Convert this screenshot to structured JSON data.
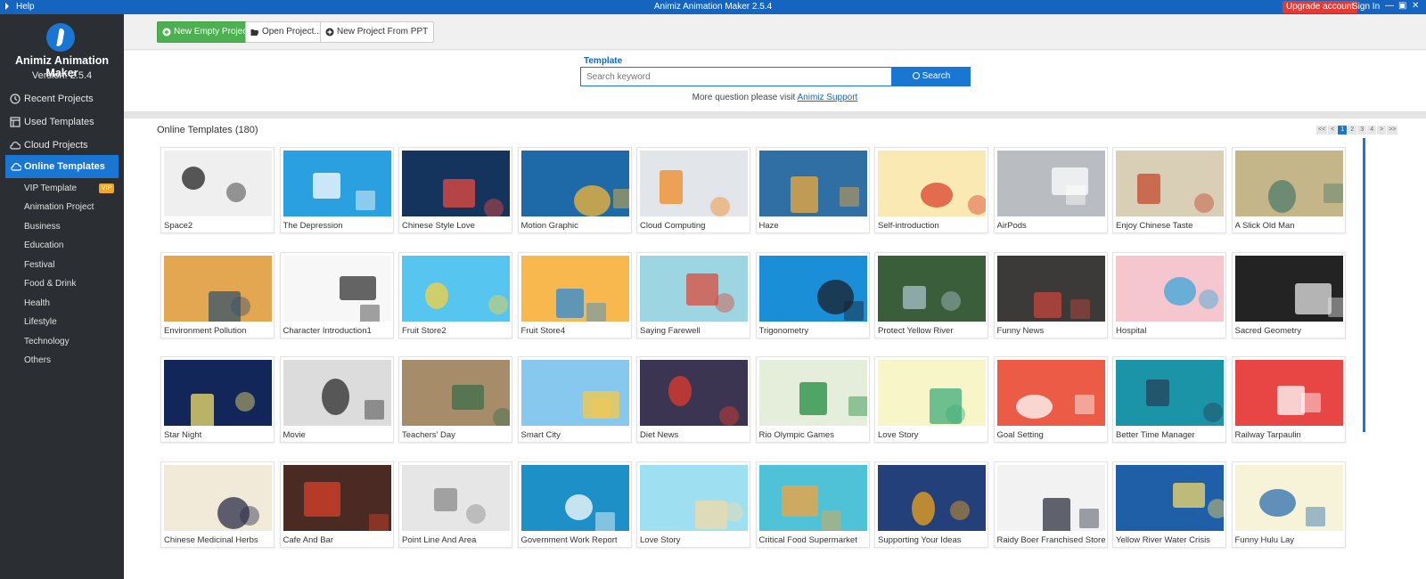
{
  "titlebar": {
    "help": "Help",
    "title": "Animiz Animation Maker 2.5.4",
    "upgrade": "Upgrade account",
    "signin": "Sign In",
    "controls": [
      "—",
      "▣",
      "❐",
      "✕"
    ]
  },
  "sidebar": {
    "brand": "Animiz Animation Maker",
    "version": "Version: 2.5.4",
    "nav": [
      {
        "label": "Recent Projects",
        "icon": "clock-icon"
      },
      {
        "label": "Used Templates",
        "icon": "template-icon"
      },
      {
        "label": "Cloud Projects",
        "icon": "cloud-icon"
      },
      {
        "label": "Online Templates",
        "icon": "cloud-icon",
        "active": true
      }
    ],
    "categories": [
      "VIP Template",
      "Animation Project",
      "Business",
      "Education",
      "Festival",
      "Food & Drink",
      "Health",
      "Lifestyle",
      "Technology",
      "Others"
    ],
    "vip_badge": "VIP"
  },
  "toolbar": {
    "new_empty": "New Empty Project",
    "open": "Open Project...",
    "new_ppt": "New Project From PPT"
  },
  "search": {
    "label": "Template",
    "placeholder": "Search keyword",
    "button": "Search",
    "support_text": "More question please visit",
    "support_link": "Animiz Support"
  },
  "templates": {
    "heading": "Online Templates (180)",
    "pager": [
      "<<",
      "<",
      "1",
      "2",
      "3",
      "4",
      ">",
      ">>"
    ],
    "current_page": "1",
    "items": [
      {
        "name": "Space2",
        "bg": "#efefef",
        "accent": "#222222"
      },
      {
        "name": "The Depression",
        "bg": "#2aa0e0",
        "accent": "#ffffff"
      },
      {
        "name": "Chinese Style Love",
        "bg": "#14345e",
        "accent": "#e94a3f"
      },
      {
        "name": "Motion Graphic",
        "bg": "#1e6aa8",
        "accent": "#f7b733"
      },
      {
        "name": "Cloud Computing",
        "bg": "#e2e6ea",
        "accent": "#f08a24"
      },
      {
        "name": "Haze",
        "bg": "#2f6fa3",
        "accent": "#f2a93b"
      },
      {
        "name": "Self-introduction",
        "bg": "#fbe9b3",
        "accent": "#d9412b"
      },
      {
        "name": "AirPods",
        "bg": "#b9bcc0",
        "accent": "#ffffff"
      },
      {
        "name": "Enjoy Chinese Taste",
        "bg": "#d9ceb6",
        "accent": "#c24a2c"
      },
      {
        "name": "A Slick Old Man",
        "bg": "#c5b68a",
        "accent": "#4e7c6a"
      },
      {
        "name": "Environment Pollution",
        "bg": "#e3a752",
        "accent": "#37536b"
      },
      {
        "name": "Character Introduction1",
        "bg": "#f7f7f7",
        "accent": "#333333"
      },
      {
        "name": "Fruit Store2",
        "bg": "#56c5f0",
        "accent": "#f7d23e"
      },
      {
        "name": "Fruit Store4",
        "bg": "#f8b84e",
        "accent": "#2e8bd8"
      },
      {
        "name": "Saying Farewell",
        "bg": "#9dd6e2",
        "accent": "#d94b3c"
      },
      {
        "name": "Trigonometry",
        "bg": "#1a8fd8",
        "accent": "#1b1f2a"
      },
      {
        "name": "Protect Yellow River",
        "bg": "#3b5e3a",
        "accent": "#a9c3c9"
      },
      {
        "name": "Funny News",
        "bg": "#3c3a38",
        "accent": "#c4463b"
      },
      {
        "name": "Hospital",
        "bg": "#f6c6cf",
        "accent": "#3aa6d8"
      },
      {
        "name": "Sacred Geometry",
        "bg": "#232323",
        "accent": "#e6e6e6"
      },
      {
        "name": "Star Night",
        "bg": "#13265a",
        "accent": "#f3e26b"
      },
      {
        "name": "Movie",
        "bg": "#dcdcdc",
        "accent": "#2b2b2b"
      },
      {
        "name": "Teachers' Day",
        "bg": "#a78c6a",
        "accent": "#3c6e4a"
      },
      {
        "name": "Smart City",
        "bg": "#86c8ee",
        "accent": "#f7c948"
      },
      {
        "name": "Diet News",
        "bg": "#3b3552",
        "accent": "#e23b2e"
      },
      {
        "name": "Rio Olympic Games",
        "bg": "#e5eedb",
        "accent": "#1e8c3f"
      },
      {
        "name": "Love Story",
        "bg": "#f8f5c8",
        "accent": "#3fae7a"
      },
      {
        "name": "Goal Setting",
        "bg": "#ec5b45",
        "accent": "#ffffff"
      },
      {
        "name": "Better Time Manager",
        "bg": "#1b94a8",
        "accent": "#24425a"
      },
      {
        "name": "Railway Tarpaulin",
        "bg": "#e84545",
        "accent": "#ffffff"
      },
      {
        "name": "Chinese Medicinal Herbs",
        "bg": "#f1ead8",
        "accent": "#2a2c4a"
      },
      {
        "name": "Cafe And Bar",
        "bg": "#4a2a22",
        "accent": "#d9412b"
      },
      {
        "name": "Point Line And Area",
        "bg": "#e6e6e6",
        "accent": "#8a8a8a"
      },
      {
        "name": "Government Work Report",
        "bg": "#1e90c8",
        "accent": "#ffffff"
      },
      {
        "name": "Love Story",
        "bg": "#9ee0f1",
        "accent": "#f3d9a4"
      },
      {
        "name": "Critical Food Supermarket",
        "bg": "#4fc2d8",
        "accent": "#f6a23a"
      },
      {
        "name": "Supporting Your Ideas",
        "bg": "#23407a",
        "accent": "#f2a31d"
      },
      {
        "name": "Raidy Boer Franchised Store",
        "bg": "#f2f2f2",
        "accent": "#2d3240"
      },
      {
        "name": "Yellow River Water Crisis",
        "bg": "#1f5fa8",
        "accent": "#f4d86b"
      },
      {
        "name": "Funny Hulu Lay",
        "bg": "#f7f3d8",
        "accent": "#2d6fb0"
      }
    ]
  }
}
